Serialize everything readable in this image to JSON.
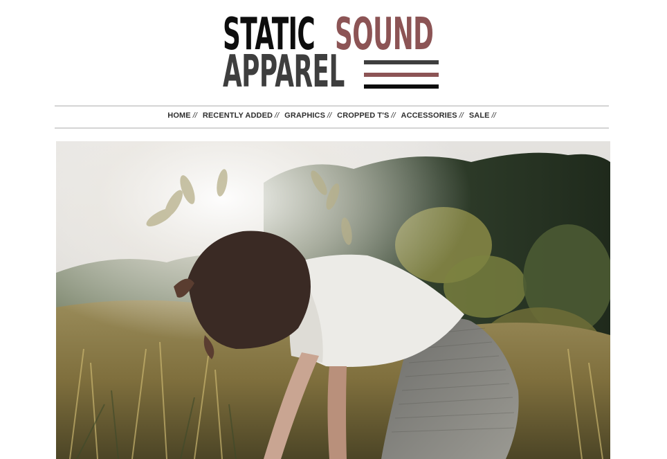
{
  "logo": {
    "line1_left": "STATIC",
    "line1_right": "SOUND",
    "line2": "APPAREL",
    "colors": {
      "dark": "#0d0d0d",
      "accent": "#8c5455",
      "gray": "#3e3e3e"
    }
  },
  "nav": {
    "items": [
      {
        "label": "HOME",
        "sep": "//"
      },
      {
        "label": "RECENTLY ADDED",
        "sep": "//"
      },
      {
        "label": "GRAPHICS",
        "sep": "//"
      },
      {
        "label": "CROPPED T'S",
        "sep": "//"
      },
      {
        "label": "ACCESSORIES",
        "sep": "//"
      },
      {
        "label": "SALE",
        "sep": "//"
      }
    ]
  },
  "hero": {
    "image": "photo-woman-in-meadow"
  }
}
